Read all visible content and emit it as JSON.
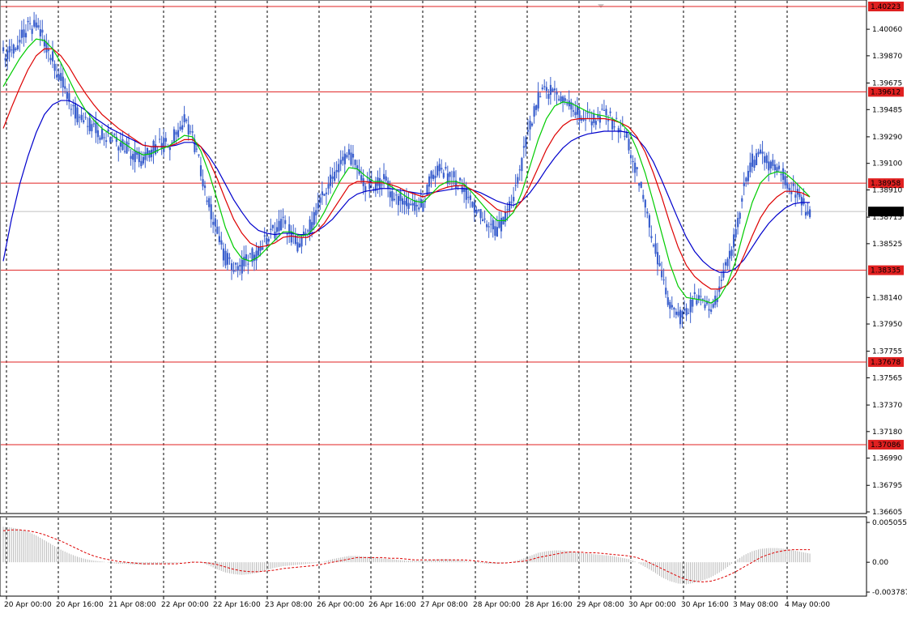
{
  "chart_data": {
    "type": "candlestick",
    "instrument_digits": 5,
    "y_ticks": [
      "1.40060",
      "1.39870",
      "1.39675",
      "1.39485",
      "1.39290",
      "1.39100",
      "1.38910",
      "1.38715",
      "1.38525",
      "1.38140",
      "1.37950",
      "1.37755",
      "1.37565",
      "1.37370",
      "1.37180",
      "1.36990",
      "1.36795",
      "1.36605"
    ],
    "ylim": [
      1.36605,
      1.40223
    ],
    "current_price": "1.38755",
    "current_price_value": 1.38755,
    "levels": [
      {
        "label": "1.40223",
        "value": 1.40223
      },
      {
        "label": "1.39612",
        "value": 1.39612
      },
      {
        "label": "1.38958",
        "value": 1.38958
      },
      {
        "label": "1.38335",
        "value": 1.38335
      },
      {
        "label": "1.37678",
        "value": 1.37678
      },
      {
        "label": "1.37086",
        "value": 1.37086
      }
    ],
    "x_labels": [
      "20 Apr 00:00",
      "20 Apr 16:00",
      "21 Apr 08:00",
      "22 Apr 00:00",
      "22 Apr 16:00",
      "23 Apr 08:00",
      "26 Apr 00:00",
      "26 Apr 16:00",
      "27 Apr 08:00",
      "28 Apr 00:00",
      "28 Apr 16:00",
      "29 Apr 08:00",
      "30 Apr 00:00",
      "30 Apr 16:00",
      "3 May 08:00",
      "4 May 00:00"
    ],
    "price_series": [
      1.3988,
      1.3992,
      1.3998,
      1.4006,
      1.4008,
      1.3998,
      1.3985,
      1.397,
      1.3955,
      1.3945,
      1.3938,
      1.3935,
      1.3932,
      1.3928,
      1.3925,
      1.3922,
      1.3916,
      1.3912,
      1.392,
      1.3925,
      1.3922,
      1.3932,
      1.394,
      1.393,
      1.3905,
      1.388,
      1.386,
      1.3842,
      1.3838,
      1.3836,
      1.3842,
      1.3848,
      1.3855,
      1.3862,
      1.3868,
      1.3858,
      1.385,
      1.3862,
      1.3874,
      1.3888,
      1.39,
      1.391,
      1.3918,
      1.3905,
      1.3895,
      1.3892,
      1.39,
      1.389,
      1.3885,
      1.3882,
      1.388,
      1.388,
      1.39,
      1.3906,
      1.39,
      1.3898,
      1.3892,
      1.388,
      1.3872,
      1.3866,
      1.3862,
      1.387,
      1.3885,
      1.391,
      1.3936,
      1.3955,
      1.3962,
      1.3962,
      1.3956,
      1.395,
      1.3945,
      1.3942,
      1.3942,
      1.3945,
      1.394,
      1.3935,
      1.3925,
      1.3902,
      1.388,
      1.3855,
      1.3828,
      1.3808,
      1.38,
      1.3802,
      1.3812,
      1.381,
      1.3805,
      1.382,
      1.3838,
      1.386,
      1.3892,
      1.3912,
      1.3914,
      1.391,
      1.3905,
      1.39,
      1.389,
      1.3882,
      1.3875
    ],
    "ma_fast": [
      1.3965,
      1.3975,
      1.3985,
      1.3993,
      1.3999,
      1.3998,
      1.3992,
      1.3982,
      1.397,
      1.3958,
      1.3948,
      1.3941,
      1.3935,
      1.3931,
      1.3927,
      1.3923,
      1.3919,
      1.3916,
      1.3917,
      1.392,
      1.3922,
      1.3926,
      1.393,
      1.3929,
      1.3919,
      1.3903,
      1.3884,
      1.3864,
      1.385,
      1.3842,
      1.384,
      1.3843,
      1.3849,
      1.3855,
      1.3861,
      1.3861,
      1.3858,
      1.3859,
      1.3865,
      1.3875,
      1.3887,
      1.3898,
      1.3907,
      1.3906,
      1.3901,
      1.3897,
      1.3897,
      1.3894,
      1.389,
      1.3886,
      1.3883,
      1.3882,
      1.3888,
      1.3894,
      1.3897,
      1.3897,
      1.3895,
      1.3889,
      1.3882,
      1.3875,
      1.3869,
      1.3869,
      1.3875,
      1.3889,
      1.3908,
      1.3927,
      1.3942,
      1.3951,
      1.3954,
      1.3953,
      1.395,
      1.3947,
      1.3945,
      1.3944,
      1.3942,
      1.3939,
      1.3933,
      1.392,
      1.3903,
      1.3882,
      1.386,
      1.3838,
      1.3822,
      1.3814,
      1.3813,
      1.3812,
      1.381,
      1.3814,
      1.3824,
      1.384,
      1.3862,
      1.3882,
      1.3896,
      1.3902,
      1.3904,
      1.3903,
      1.3898,
      1.3892,
      1.3886
    ],
    "ma_mid": [
      1.3935,
      1.395,
      1.3964,
      1.3977,
      1.3987,
      1.3992,
      1.3992,
      1.3987,
      1.3979,
      1.3969,
      1.396,
      1.3952,
      1.3945,
      1.394,
      1.3935,
      1.3931,
      1.3927,
      1.3923,
      1.3922,
      1.3922,
      1.3922,
      1.3924,
      1.3927,
      1.3927,
      1.3922,
      1.3912,
      1.3899,
      1.3884,
      1.387,
      1.386,
      1.3853,
      1.385,
      1.3851,
      1.3853,
      1.3857,
      1.3858,
      1.3857,
      1.3857,
      1.3861,
      1.3867,
      1.3876,
      1.3885,
      1.3894,
      1.3897,
      1.3897,
      1.3896,
      1.3896,
      1.3895,
      1.3893,
      1.389,
      1.3888,
      1.3886,
      1.3888,
      1.3891,
      1.3893,
      1.3894,
      1.3894,
      1.3891,
      1.3887,
      1.3882,
      1.3877,
      1.3875,
      1.3876,
      1.3883,
      1.3894,
      1.3907,
      1.392,
      1.393,
      1.3937,
      1.3941,
      1.3942,
      1.3942,
      1.3942,
      1.3942,
      1.3941,
      1.3939,
      1.3936,
      1.3929,
      1.3918,
      1.3903,
      1.3886,
      1.3867,
      1.385,
      1.3837,
      1.3829,
      1.3824,
      1.382,
      1.382,
      1.3823,
      1.3831,
      1.3844,
      1.3858,
      1.3871,
      1.388,
      1.3886,
      1.389,
      1.389,
      1.3889,
      1.3886
    ],
    "ma_slow": [
      1.384,
      1.387,
      1.3895,
      1.3915,
      1.3932,
      1.3945,
      1.3952,
      1.3955,
      1.3955,
      1.3952,
      1.3948,
      1.3943,
      1.3939,
      1.3935,
      1.3932,
      1.3929,
      1.3926,
      1.3923,
      1.3922,
      1.3922,
      1.3922,
      1.3923,
      1.3925,
      1.3925,
      1.3922,
      1.3915,
      1.3906,
      1.3895,
      1.3884,
      1.3875,
      1.3867,
      1.3862,
      1.386,
      1.3859,
      1.386,
      1.386,
      1.3859,
      1.3859,
      1.3861,
      1.3865,
      1.387,
      1.3877,
      1.3884,
      1.3888,
      1.389,
      1.3891,
      1.3892,
      1.3892,
      1.3891,
      1.389,
      1.3889,
      1.3888,
      1.3889,
      1.389,
      1.3891,
      1.3892,
      1.3892,
      1.3891,
      1.3889,
      1.3886,
      1.3883,
      1.3881,
      1.388,
      1.3883,
      1.3889,
      1.3897,
      1.3906,
      1.3914,
      1.3921,
      1.3926,
      1.3929,
      1.3931,
      1.3932,
      1.3933,
      1.3933,
      1.3933,
      1.3932,
      1.3928,
      1.3921,
      1.3911,
      1.3898,
      1.3884,
      1.387,
      1.3857,
      1.3847,
      1.384,
      1.3835,
      1.3832,
      1.3832,
      1.3835,
      1.3841,
      1.385,
      1.3859,
      1.3867,
      1.3873,
      1.3878,
      1.3881,
      1.3882,
      1.3882
    ],
    "osc_ticks": [
      "0.005055",
      "0.00",
      "-0.003787"
    ],
    "osc_ylim": [
      -0.003787,
      0.005055
    ],
    "osc_hist": [
      0.0045,
      0.0044,
      0.0042,
      0.0039,
      0.0034,
      0.0028,
      0.0022,
      0.0016,
      0.0011,
      0.0007,
      0.0004,
      0.0002,
      0.0001,
      -0.0001,
      -0.0002,
      -0.0002,
      -0.0003,
      -0.0003,
      -0.0003,
      -0.0003,
      -0.0002,
      -0.0001,
      0.0,
      0.0001,
      0.0,
      -0.0004,
      -0.0009,
      -0.0013,
      -0.0015,
      -0.0016,
      -0.0015,
      -0.0013,
      -0.001,
      -0.0007,
      -0.0005,
      -0.0004,
      -0.0003,
      -0.0002,
      -0.0001,
      0.0001,
      0.0004,
      0.0006,
      0.0008,
      0.0008,
      0.0007,
      0.0006,
      0.0005,
      0.0004,
      0.0003,
      0.0002,
      0.0002,
      0.0002,
      0.0003,
      0.0004,
      0.0004,
      0.0003,
      0.0002,
      0.0,
      -0.0001,
      -0.0002,
      -0.0002,
      -0.0001,
      0.0001,
      0.0004,
      0.0008,
      0.0012,
      0.0014,
      0.0015,
      0.0015,
      0.0014,
      0.0012,
      0.0011,
      0.001,
      0.0009,
      0.0008,
      0.0006,
      0.0004,
      0.0,
      -0.0006,
      -0.0012,
      -0.0019,
      -0.0024,
      -0.0027,
      -0.0028,
      -0.0026,
      -0.0023,
      -0.0019,
      -0.0013,
      -0.0006,
      0.0002,
      0.0009,
      0.0014,
      0.0017,
      0.0018,
      0.0018,
      0.0017,
      0.0015,
      0.0013,
      0.0011
    ],
    "osc_signal": [
      0.004,
      0.0041,
      0.0041,
      0.004,
      0.0038,
      0.0035,
      0.0031,
      0.0027,
      0.0022,
      0.0017,
      0.0012,
      0.0008,
      0.0005,
      0.0003,
      0.0001,
      0.0,
      -0.0001,
      -0.0002,
      -0.0002,
      -0.0002,
      -0.0002,
      -0.0002,
      -0.0001,
      0.0,
      0.0,
      -0.0001,
      -0.0003,
      -0.0006,
      -0.0009,
      -0.0011,
      -0.0012,
      -0.0012,
      -0.0011,
      -0.001,
      -0.0008,
      -0.0007,
      -0.0006,
      -0.0005,
      -0.0004,
      -0.0002,
      0.0,
      0.0002,
      0.0004,
      0.0006,
      0.0006,
      0.0006,
      0.0006,
      0.0005,
      0.0005,
      0.0004,
      0.0003,
      0.0003,
      0.0003,
      0.0003,
      0.0003,
      0.0003,
      0.0003,
      0.0002,
      0.0001,
      0.0,
      -0.0001,
      -0.0001,
      0.0,
      0.0001,
      0.0003,
      0.0006,
      0.0008,
      0.001,
      0.0012,
      0.0013,
      0.0013,
      0.0012,
      0.0012,
      0.0011,
      0.001,
      0.0009,
      0.0008,
      0.0006,
      0.0002,
      -0.0003,
      -0.0008,
      -0.0013,
      -0.0018,
      -0.0022,
      -0.0024,
      -0.0025,
      -0.0024,
      -0.0021,
      -0.0017,
      -0.0012,
      -0.0006,
      0.0,
      0.0006,
      0.001,
      0.0013,
      0.0015,
      0.0016,
      0.0016,
      0.0016
    ],
    "colors": {
      "candle": "#3a5fcd",
      "ma_fast": "#00cc00",
      "ma_mid": "#dd0000",
      "ma_slow": "#0000cc",
      "level_line": "#e02020",
      "level_box": "#e02020",
      "current_box": "#000000",
      "histogram": "#b8b8b8",
      "signal": "#dd0000",
      "grid": "#000000"
    }
  }
}
